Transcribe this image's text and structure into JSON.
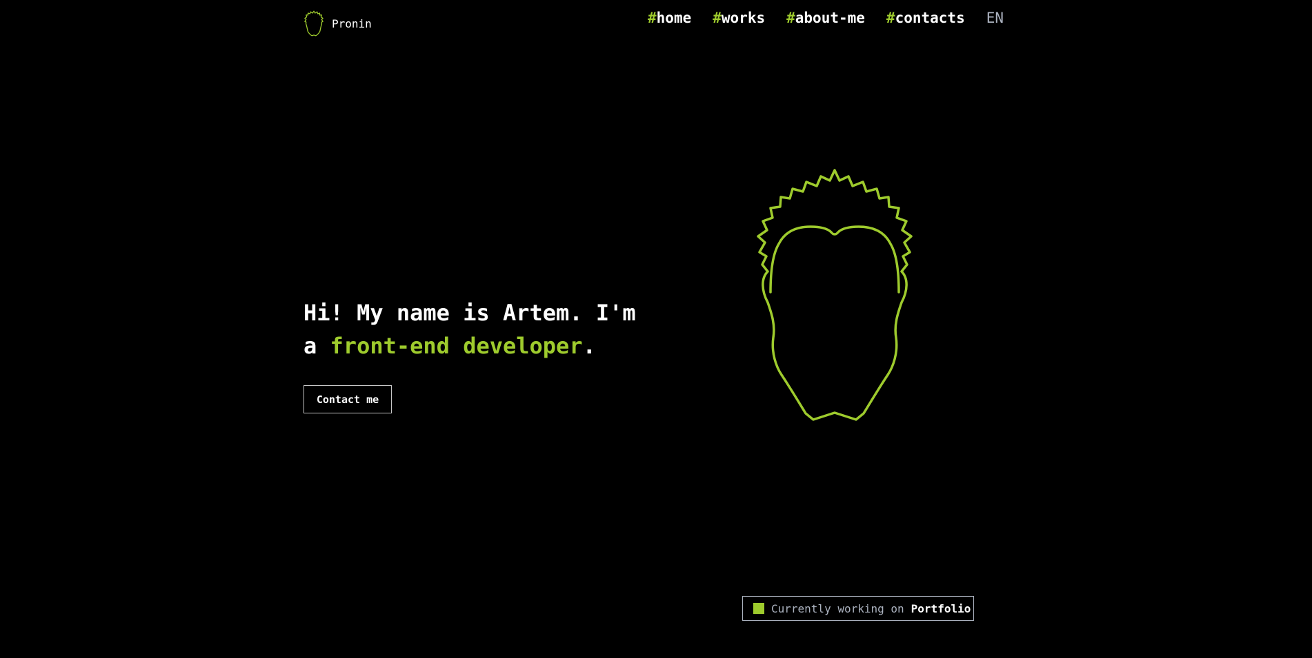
{
  "brand": {
    "name": "Pronin",
    "logo_icon": "head-outline-icon"
  },
  "nav": {
    "hash": "#",
    "items": [
      {
        "label": "home"
      },
      {
        "label": "works"
      },
      {
        "label": "about-me"
      },
      {
        "label": "contacts"
      }
    ],
    "language": "EN"
  },
  "hero": {
    "title_start": "Hi! My name is Artem. I'm a",
    "title_accent": "front-end developer",
    "title_end": ".",
    "cta_label": "Contact me",
    "illustration_icon": "head-outline-icon"
  },
  "status": {
    "prefix": "Currently working on",
    "project": "Portfolio"
  },
  "colors": {
    "background": "#000000",
    "accent": "#9ecb2d",
    "text": "#ffffff",
    "muted": "#abb2bf"
  }
}
